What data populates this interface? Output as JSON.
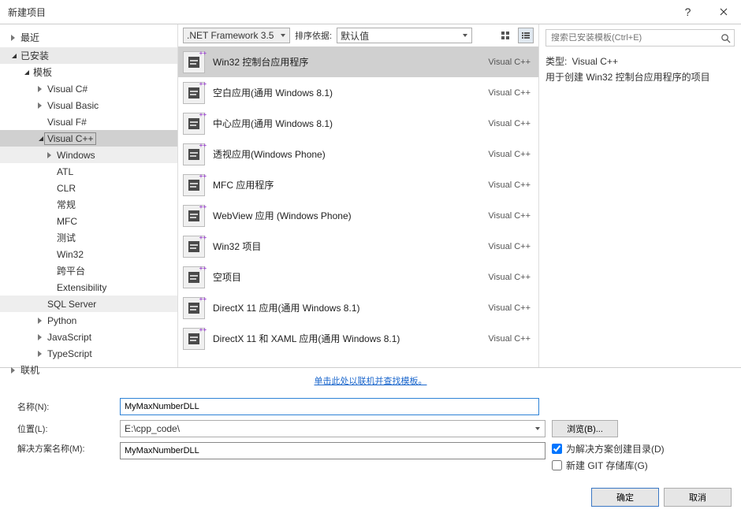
{
  "title": "新建项目",
  "sidebar": {
    "recent": "最近",
    "installed": "已安装",
    "templates_root": "模板",
    "templates": [
      "Visual C#",
      "Visual Basic",
      "Visual F#",
      "Visual C++"
    ],
    "cpp_children": [
      "Windows",
      "ATL",
      "CLR",
      "常规",
      "MFC",
      "测试",
      "Win32",
      "跨平台",
      "Extensibility"
    ],
    "after": [
      "SQL Server",
      "Python",
      "JavaScript",
      "TypeScript"
    ],
    "online": "联机"
  },
  "toolbar": {
    "framework": ".NET Framework 3.5",
    "sort_label": "排序依据:",
    "sort_value": "默认值"
  },
  "templates": [
    {
      "name": "Win32 控制台应用程序",
      "lang": "Visual C++",
      "selected": true
    },
    {
      "name": "空白应用(通用 Windows 8.1)",
      "lang": "Visual C++"
    },
    {
      "name": "中心应用(通用 Windows 8.1)",
      "lang": "Visual C++"
    },
    {
      "name": "透视应用(Windows Phone)",
      "lang": "Visual C++"
    },
    {
      "name": "MFC 应用程序",
      "lang": "Visual C++"
    },
    {
      "name": "WebView 应用 (Windows Phone)",
      "lang": "Visual C++"
    },
    {
      "name": "Win32 项目",
      "lang": "Visual C++"
    },
    {
      "name": "空项目",
      "lang": "Visual C++"
    },
    {
      "name": "DirectX 11 应用(通用 Windows 8.1)",
      "lang": "Visual C++"
    },
    {
      "name": "DirectX 11 和 XAML 应用(通用 Windows 8.1)",
      "lang": "Visual C++"
    }
  ],
  "search_placeholder": "搜索已安装模板(Ctrl+E)",
  "desc": {
    "type_label": "类型:",
    "type_value": "Visual C++",
    "text": "用于创建 Win32 控制台应用程序的项目"
  },
  "links": {
    "online": "单击此处以联机并查找模板。"
  },
  "form": {
    "name_label": "名称(N):",
    "name_value": "MyMaxNumberDLL",
    "location_label": "位置(L):",
    "location_value": "E:\\cpp_code\\",
    "sln_label": "解决方案名称(M):",
    "sln_value": "MyMaxNumberDLL",
    "browse": "浏览(B)...",
    "chk_dir": "为解决方案创建目录(D)",
    "chk_git": "新建 GIT 存储库(G)"
  },
  "footer": {
    "ok": "确定",
    "cancel": "取消"
  }
}
